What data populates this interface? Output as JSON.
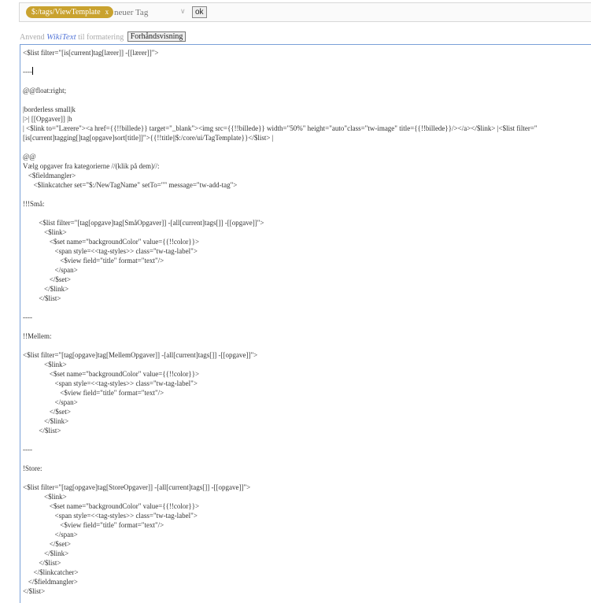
{
  "tagbar": {
    "tag_label": "$:/tags/ViewTemplate",
    "tag_remove": "x",
    "input_placeholder": "neuer Tag",
    "ok_label": "ok"
  },
  "format": {
    "prefix": "Anvend",
    "wikitext": "WikiText",
    "suffix": "til formatering",
    "preview_label": "Forhåndsvisning"
  },
  "editor": {
    "lines": [
      "<$list filter=\"[is[current]tag[lærer]] -[[lærer]]\">",
      "",
      "----",
      "",
      "@@float:right;",
      "",
      "|borderless small|k",
      "|>| [[Opgaver]] |h",
      "| <$link to=\"Lærere\"><a href={{!!billede}} target=\"_blank\"><img src={{!!billede}} width=\"50%\" height=\"auto\"class=\"tw-image\" title={{!!billede}}/></a></$link> |<$list filter=\"",
      "[is[current]tagging[]tag[opgave]sort[title]]\">{{!!title||$:/core/ui/TagTemplate}}</$list> |",
      "",
      "@@",
      "Vælg opgaver fra kategorierne //(klik på dem)//:",
      "   <$fieldmangler>",
      "      <$linkcatcher set=\"$:/NewTagName\" setTo=\"\" message=\"tw-add-tag\">",
      "",
      "!!!Små:",
      "",
      "         <$list filter=\"[tag[opgave]tag[SmåOpgaver]] -[all[current]tags[]] -[[opgave]]\">",
      "            <$link>",
      "               <$set name=\"backgroundColor\" value={{!!color}}>",
      "                  <span style=<<tag-styles>> class=\"tw-tag-label\">",
      "                     <$view field=\"title\" format=\"text\"/>",
      "                  </span>",
      "               </$set>",
      "            </$link>",
      "         </$list>",
      "",
      "----",
      "",
      "!!Mellem:",
      "",
      "<$list filter=\"[tag[opgave]tag[MellemOpgaver]] -[all[current]tags[]] -[[opgave]]\">",
      "            <$link>",
      "               <$set name=\"backgroundColor\" value={{!!color}}>",
      "                  <span style=<<tag-styles>> class=\"tw-tag-label\">",
      "                     <$view field=\"title\" format=\"text\"/>",
      "                  </span>",
      "               </$set>",
      "            </$link>",
      "         </$list>",
      "",
      "----",
      "",
      "!Store:",
      "",
      "<$list filter=\"[tag[opgave]tag[StoreOpgaver]] -[all[current]tags[]] -[[opgave]]\">",
      "            <$link>",
      "               <$set name=\"backgroundColor\" value={{!!color}}>",
      "                  <span style=<<tag-styles>> class=\"tw-tag-label\">",
      "                     <$view field=\"title\" format=\"text\"/>",
      "                  </span>",
      "               </$set>",
      "            </$link>",
      "         </$list>",
      "      </$linkcatcher>",
      "   </$fieldmangler>",
      "</$list>"
    ]
  },
  "colors": {
    "tag_bg": "#c9a22f",
    "link": "#5778d8",
    "editor_border": "#7aa0d8"
  }
}
